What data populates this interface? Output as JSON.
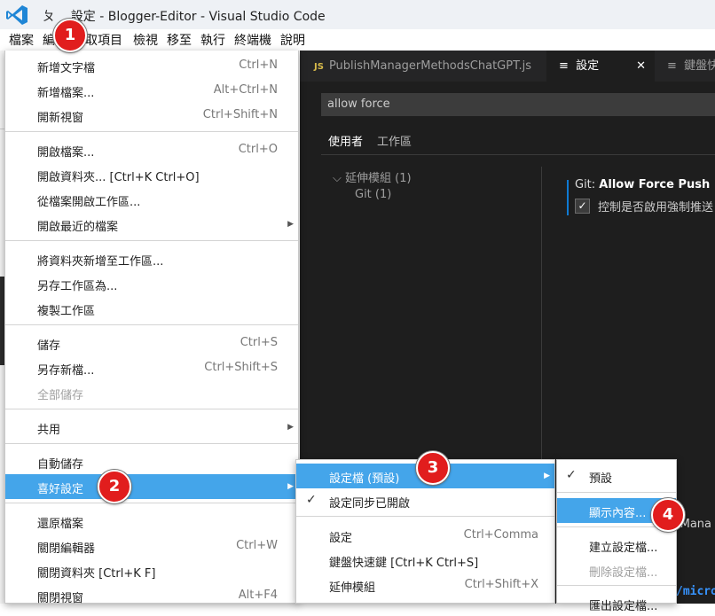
{
  "window": {
    "title_prefix": "ㄆ",
    "title": "設定 - Blogger-Editor - Visual Studio Code",
    "icon": "vscode-icon"
  },
  "menubar": {
    "items": [
      "檔案",
      "編",
      "取項目",
      "檢視",
      "移至",
      "執行",
      "終端機",
      "說明"
    ]
  },
  "editor": {
    "tabs": [
      {
        "icon_text": "JS",
        "label": "PublishManagerMethodsChatGPT.js"
      },
      {
        "icon_text": "≡",
        "label": "設定",
        "close": "✕"
      },
      {
        "icon_text": "≡",
        "label": "鍵盤快"
      }
    ],
    "search_value": "allow force",
    "scope_tabs": [
      "使用者",
      "工作區"
    ],
    "toc": {
      "group_label": "延伸模組 (1)",
      "child_label": "Git (1)",
      "chevron": "⌵"
    },
    "setting": {
      "category": "Git: ",
      "name": "Allow Force Push",
      "checked": true,
      "description": "控制是否啟用強制推送"
    },
    "peek": {
      "text1": "lMana",
      "text2": "/micro"
    }
  },
  "file_menu": {
    "groups": [
      [
        {
          "label": "新增文字檔",
          "shortcut": "Ctrl+N"
        },
        {
          "label": "新增檔案...",
          "shortcut": "Alt+Ctrl+N"
        },
        {
          "label": "開新視窗",
          "shortcut": "Ctrl+Shift+N"
        }
      ],
      [
        {
          "label": "開啟檔案...",
          "shortcut": "Ctrl+O"
        },
        {
          "label": "開啟資料夾... [Ctrl+K Ctrl+O]",
          "shortcut": ""
        },
        {
          "label": "從檔案開啟工作區...",
          "shortcut": ""
        },
        {
          "label": "開啟最近的檔案",
          "shortcut": "",
          "submenu": true
        }
      ],
      [
        {
          "label": "將資料夾新增至工作區...",
          "shortcut": ""
        },
        {
          "label": "另存工作區為...",
          "shortcut": ""
        },
        {
          "label": "複製工作區",
          "shortcut": ""
        }
      ],
      [
        {
          "label": "儲存",
          "shortcut": "Ctrl+S"
        },
        {
          "label": "另存新檔...",
          "shortcut": "Ctrl+Shift+S"
        },
        {
          "label": "全部儲存",
          "shortcut": "",
          "disabled": true
        }
      ],
      [
        {
          "label": "共用",
          "shortcut": "",
          "submenu": true
        }
      ],
      [
        {
          "label": "自動儲存",
          "shortcut": ""
        },
        {
          "label": "喜好設定",
          "shortcut": "",
          "submenu": true,
          "highlight": true
        }
      ],
      [
        {
          "label": "還原檔案",
          "shortcut": ""
        },
        {
          "label": "關閉編輯器",
          "shortcut": "Ctrl+W"
        },
        {
          "label": "關閉資料夾 [Ctrl+K F]",
          "shortcut": ""
        },
        {
          "label": "關閉視窗",
          "shortcut": "Alt+F4"
        }
      ]
    ]
  },
  "preferences_menu": {
    "items": [
      {
        "label": "設定檔 (預設)",
        "submenu": true,
        "highlight": true
      },
      {
        "label": "設定同步已開啟",
        "checked": true
      },
      {
        "label": "設定",
        "shortcut": "Ctrl+Comma"
      },
      {
        "label": "鍵盤快速鍵 [Ctrl+K Ctrl+S]",
        "shortcut": ""
      },
      {
        "label": "延伸模組",
        "shortcut": "Ctrl+Shift+X"
      }
    ]
  },
  "profiles_menu": {
    "items": [
      {
        "label": "預設",
        "checked": true
      },
      {
        "label": "顯示內容...",
        "highlight": true
      },
      {
        "label": "建立設定檔..."
      },
      {
        "label": "刪除設定檔...",
        "disabled": true
      },
      {
        "label": "匯出設定檔..."
      }
    ]
  },
  "steps": [
    "1",
    "2",
    "3",
    "4"
  ],
  "colors": {
    "highlight": "#44a5ea",
    "step_marker": "#e11d1d",
    "editor_bg": "#1e1e1e",
    "vscode_blue": "#0e7ad3"
  }
}
